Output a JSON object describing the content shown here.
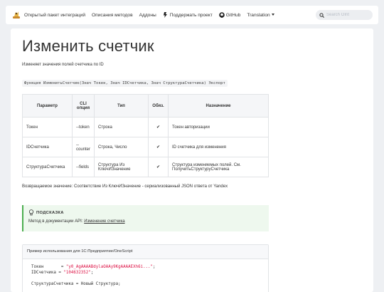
{
  "nav": {
    "items": [
      {
        "label": "Открытый пакет интеграций"
      },
      {
        "label": "Описания методов"
      },
      {
        "label": "Аддоны"
      },
      {
        "label": "Поддержать проект"
      },
      {
        "label": "GitHub"
      },
      {
        "label": "Translation"
      }
    ],
    "search_placeholder": "Search OInt"
  },
  "page": {
    "title": "Изменить счетчик",
    "description": "Изменяет значения полей счетчика по ID",
    "signature": "Функция ИзменитьСчетчик(Знач Токен, Знач IDСчетчика, Знач СтруктураСчетчика) Экспорт"
  },
  "table": {
    "headers": [
      "Параметр",
      "CLI опция",
      "Тип",
      "Обяз.",
      "Назначение"
    ],
    "rows": [
      [
        "Токен",
        "--token",
        "Строка",
        "✔",
        "Токен авторизации"
      ],
      [
        "IDСчетчика",
        "--counter",
        "Строка, Число",
        "✔",
        "ID счетчика для изменения"
      ],
      [
        "СтруктураСчетчика",
        "--fields",
        "Структура Из КлючИЗначение",
        "✔",
        "Структура изменяемых полей. См. ПолучитьСтруктуруСчетчика"
      ]
    ]
  },
  "returns": "Возвращаемое значение: Соответствие Из КлючИЗначение - сериализованный JSON ответа от Yandex",
  "tip": {
    "title": "ПОДСКАЗКА",
    "text": "Метод в документации API: ",
    "link": "Изменение счетчика"
  },
  "example": {
    "title": "Пример использования для 1С:Предприятие/OneScript",
    "line1_var": "Токен       = ",
    "line1_val": "\"y0_AgAAAABdylaOAAy9KgAAAAEXh6i...\"",
    "line2_var": "IDСчетчика = ",
    "line2_val": "\"104632352\"",
    "line3": "СтруктураСчетчика = Новый Структура;"
  },
  "colors": {
    "accent_green": "#4caf50",
    "tip_bg": "#eef8ee",
    "string_red": "#d14"
  }
}
